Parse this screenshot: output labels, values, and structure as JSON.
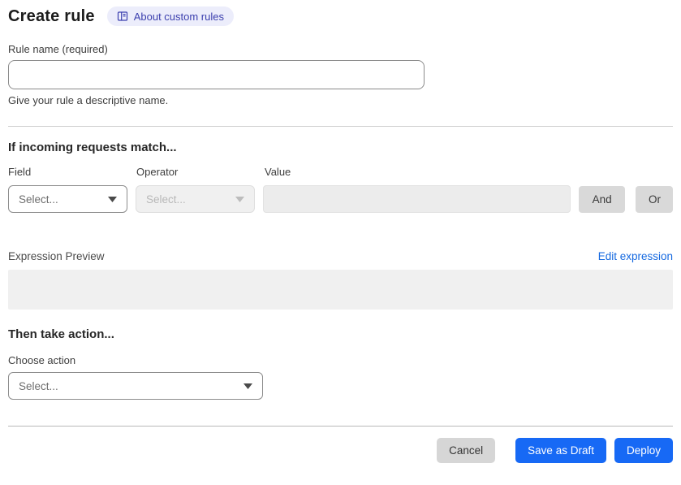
{
  "header": {
    "title": "Create rule",
    "badge": {
      "label": "About custom rules",
      "icon": "book-icon"
    }
  },
  "rule_name": {
    "label": "Rule name (required)",
    "value": "",
    "helper": "Give your rule a descriptive name."
  },
  "match_section": {
    "heading": "If incoming requests match...",
    "field": {
      "label": "Field",
      "selected": "Select..."
    },
    "operator": {
      "label": "Operator",
      "selected": "Select...",
      "disabled": true
    },
    "value": {
      "label": "Value",
      "value": "",
      "disabled": true
    },
    "and_button": "And",
    "or_button": "Or",
    "expression_preview_label": "Expression Preview",
    "edit_expression_link": "Edit expression",
    "expression_preview_value": ""
  },
  "action_section": {
    "heading": "Then take action...",
    "choose_action_label": "Choose action",
    "selected": "Select..."
  },
  "footer": {
    "cancel_label": "Cancel",
    "save_draft_label": "Save as Draft",
    "deploy_label": "Deploy"
  },
  "colors": {
    "primary_blue": "#1769f5",
    "link_blue": "#1569e0",
    "badge_bg": "#ecedfb",
    "badge_text": "#3b3fae",
    "disabled_fill": "#ececec",
    "neutral_button": "#d9d9d9"
  }
}
